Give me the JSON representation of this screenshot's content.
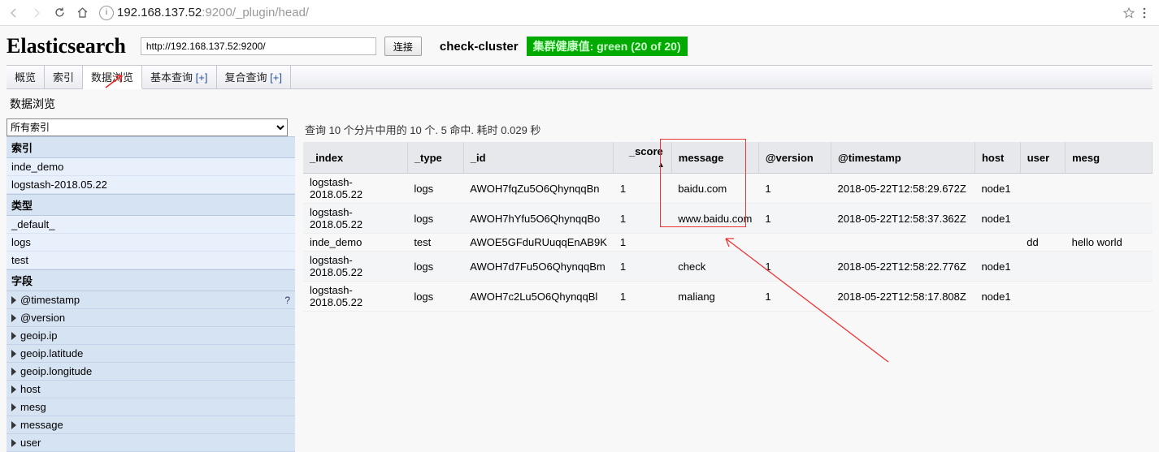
{
  "browser": {
    "url_host": "192.168.137.52",
    "url_port": ":9200/",
    "url_path": "_plugin/head/"
  },
  "header": {
    "logo": "Elasticsearch",
    "conn_url": "http://192.168.137.52:9200/",
    "conn_btn": "连接",
    "cluster": "check-cluster",
    "health": "集群健康值: green (20 of 20)"
  },
  "tabs": {
    "items": [
      "概览",
      "索引",
      "数据浏览",
      "基本查询 ",
      "复合查询 "
    ],
    "plus": "[+]",
    "active_index": 2
  },
  "subtitle": "数据浏览",
  "sidebar": {
    "all_indices_label": "所有索引",
    "sec1": "索引",
    "indices": [
      "inde_demo",
      "logstash-2018.05.22"
    ],
    "sec2": "类型",
    "types": [
      "_default_",
      "logs",
      "test"
    ],
    "sec3": "字段",
    "fields": [
      "@timestamp",
      "@version",
      "geoip.ip",
      "geoip.latitude",
      "geoip.longitude",
      "host",
      "mesg",
      "message",
      "user"
    ]
  },
  "query_info": "查询 10 个分片中用的 10 个. 5 命中. 耗时 0.029 秒",
  "columns": [
    "_index",
    "_type",
    "_id",
    "_score",
    "message",
    "@version",
    "@timestamp",
    "host",
    "user",
    "mesg"
  ],
  "sort_col": "_score",
  "rows": [
    {
      "_index": "logstash-2018.05.22",
      "_type": "logs",
      "_id": "AWOH7fqZu5O6QhynqqBn",
      "_score": "1",
      "message": "baidu.com",
      "@version": "1",
      "@timestamp": "2018-05-22T12:58:29.672Z",
      "host": "node1",
      "user": "",
      "mesg": ""
    },
    {
      "_index": "logstash-2018.05.22",
      "_type": "logs",
      "_id": "AWOH7hYfu5O6QhynqqBo",
      "_score": "1",
      "message": "www.baidu.com",
      "@version": "1",
      "@timestamp": "2018-05-22T12:58:37.362Z",
      "host": "node1",
      "user": "",
      "mesg": ""
    },
    {
      "_index": "inde_demo",
      "_type": "test",
      "_id": "AWOE5GFduRUuqqEnAB9K",
      "_score": "1",
      "message": "",
      "@version": "",
      "@timestamp": "",
      "host": "",
      "user": "dd",
      "mesg": "hello world"
    },
    {
      "_index": "logstash-2018.05.22",
      "_type": "logs",
      "_id": "AWOH7d7Fu5O6QhynqqBm",
      "_score": "1",
      "message": "check",
      "@version": "1",
      "@timestamp": "2018-05-22T12:58:22.776Z",
      "host": "node1",
      "user": "",
      "mesg": ""
    },
    {
      "_index": "logstash-2018.05.22",
      "_type": "logs",
      "_id": "AWOH7c2Lu5O6QhynqqBl",
      "_score": "1",
      "message": "maliang",
      "@version": "1",
      "@timestamp": "2018-05-22T12:58:17.808Z",
      "host": "node1",
      "user": "",
      "mesg": ""
    }
  ]
}
